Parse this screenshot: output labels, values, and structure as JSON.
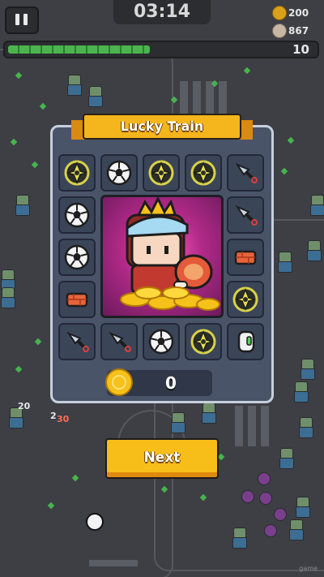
{
  "hud": {
    "timer": "03:14",
    "resources": [
      {
        "name": "coins",
        "icon": "coin-icon",
        "value": "200",
        "color": "#d9a11b"
      },
      {
        "name": "kills",
        "icon": "skull-icon",
        "value": "867",
        "color": "#c7b6a3"
      }
    ],
    "level": "10",
    "xp_progress": 0.5
  },
  "dialog": {
    "title": "Lucky Train",
    "slots": [
      "shuriken",
      "soccer-ball",
      "shuriken",
      "shuriken",
      "kunai",
      "soccer-ball",
      "kunai",
      "soccer-ball",
      "brick",
      "brick",
      "shuriken",
      "kunai",
      "kunai",
      "soccer-ball",
      "shuriken",
      "fuel-canister"
    ],
    "hero": "king-character",
    "coins_won": "0",
    "next_label": "Next"
  },
  "world": {
    "damage_numbers": [
      "20",
      "2",
      "30"
    ]
  },
  "watermark": "game",
  "colors": {
    "accent": "#f5b51c",
    "panel": "#4a5468",
    "hero_bg": "#d6369f"
  }
}
